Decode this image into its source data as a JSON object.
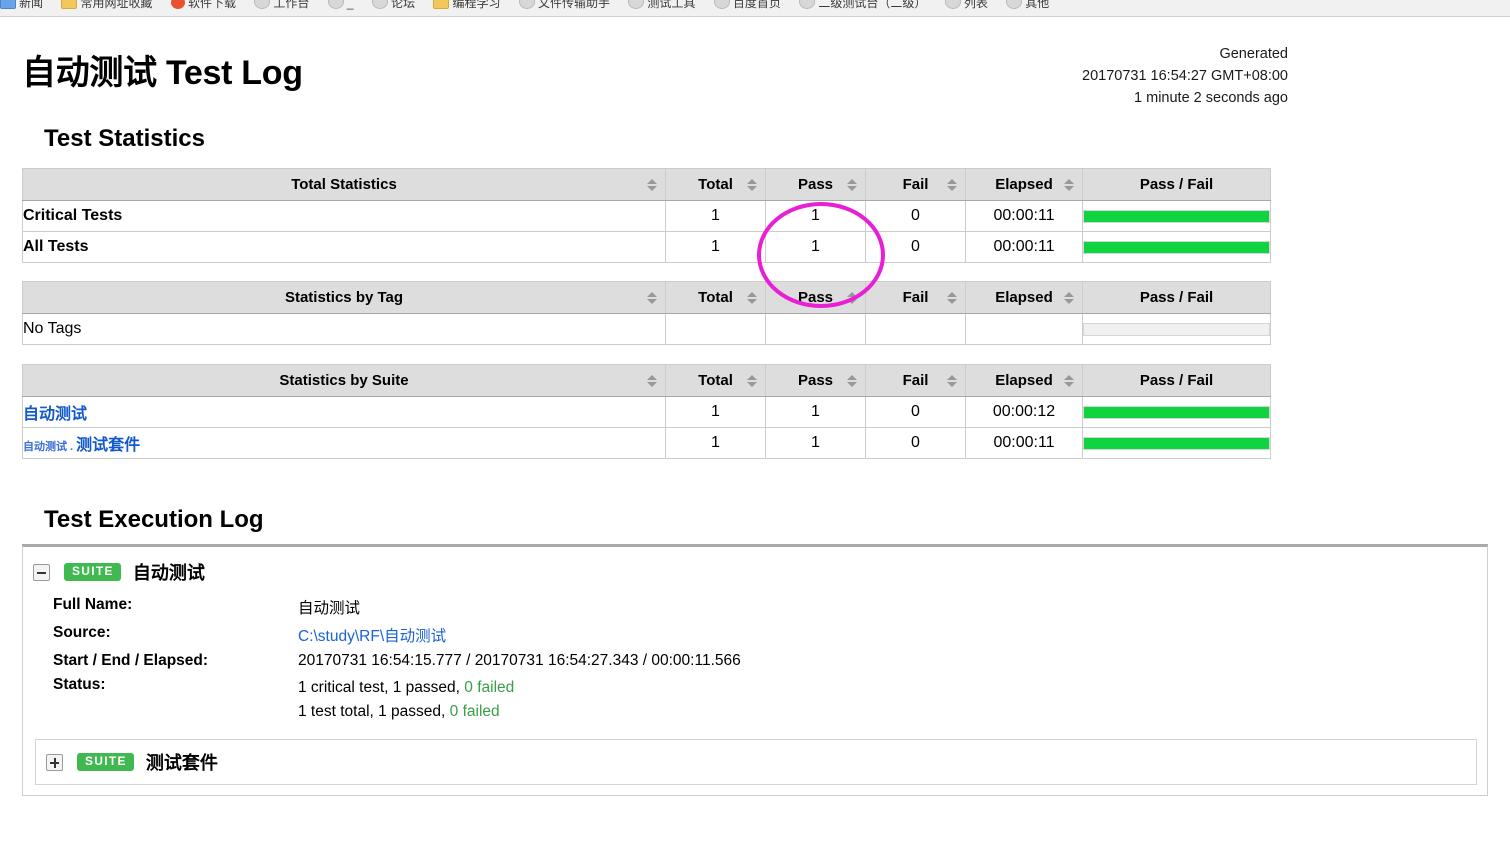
{
  "browser": {
    "bookmarks": [
      {
        "icon": "page-icon",
        "label": "新闻"
      },
      {
        "icon": "folder-icon",
        "label": "常用网址收藏"
      },
      {
        "icon": "red-circle-icon",
        "label": "软件下载"
      },
      {
        "icon": "globe-icon",
        "label": "工作台"
      },
      {
        "icon": "globe-icon",
        "label": "_"
      },
      {
        "icon": "globe-icon",
        "label": "论坛"
      },
      {
        "icon": "folder-icon",
        "label": "编程学习"
      },
      {
        "icon": "globe-icon",
        "label": "文件传输助手"
      },
      {
        "icon": "globe-icon",
        "label": "测试工具"
      },
      {
        "icon": "globe-icon",
        "label": "百度首页"
      },
      {
        "icon": "globe-icon",
        "label": "二级测试台（二级）"
      },
      {
        "icon": "globe-icon",
        "label": "列表"
      },
      {
        "icon": "globe-icon",
        "label": "其他"
      }
    ]
  },
  "report": {
    "title": "自动测试 Test Log",
    "generated_label": "Generated",
    "generated_time": "20170731 16:54:27 GMT+08:00",
    "generated_ago": "1 minute 2 seconds ago"
  },
  "sections": {
    "statistics_heading": "Test Statistics",
    "execution_heading": "Test Execution Log"
  },
  "columns": {
    "total": "Total",
    "pass": "Pass",
    "fail": "Fail",
    "elapsed": "Elapsed",
    "passfail": "Pass / Fail"
  },
  "tables": [
    {
      "id": "total-statistics",
      "name_header": "Total Statistics",
      "rows": [
        {
          "name": "Critical Tests",
          "bold": true,
          "link": false,
          "total": "1",
          "pass": "1",
          "fail": "0",
          "elapsed": "00:00:11",
          "pass_pct": 100
        },
        {
          "name": "All Tests",
          "bold": true,
          "link": false,
          "total": "1",
          "pass": "1",
          "fail": "0",
          "elapsed": "00:00:11",
          "pass_pct": 100
        }
      ]
    },
    {
      "id": "statistics-by-tag",
      "name_header": "Statistics by Tag",
      "rows": [
        {
          "name": "No Tags",
          "bold": false,
          "link": false,
          "total": "",
          "pass": "",
          "fail": "",
          "elapsed": "",
          "pass_pct": -1
        }
      ]
    },
    {
      "id": "statistics-by-suite",
      "name_header": "Statistics by Suite",
      "rows": [
        {
          "name": "自动测试",
          "parent": "",
          "bold": false,
          "link": true,
          "total": "1",
          "pass": "1",
          "fail": "0",
          "elapsed": "00:00:12",
          "pass_pct": 100
        },
        {
          "name": "测试套件",
          "parent": "自动测试 . ",
          "bold": false,
          "link": true,
          "total": "1",
          "pass": "1",
          "fail": "0",
          "elapsed": "00:00:11",
          "pass_pct": 100
        }
      ]
    }
  ],
  "execution_log": {
    "root_suite": {
      "badge": "SUITE",
      "name": "自动测试",
      "toggle_state": "expanded",
      "meta": [
        {
          "label": "Full Name:",
          "value": "自动测试",
          "is_link": false
        },
        {
          "label": "Source:",
          "value": "C:\\study\\RF\\自动测试",
          "is_link": true
        },
        {
          "label": "Start / End / Elapsed:",
          "value": "20170731 16:54:15.777 / 20170731 16:54:27.343 / 00:00:11.566",
          "is_link": false
        }
      ],
      "status_label": "Status:",
      "status_lines": [
        {
          "text": "1 critical test, 1 passed, ",
          "highlight": "0 failed"
        },
        {
          "text": "1 test total, 1 passed, ",
          "highlight": "0 failed"
        }
      ]
    },
    "child_suite": {
      "badge": "SUITE",
      "name": "测试套件",
      "toggle_state": "collapsed"
    }
  },
  "annotation": {
    "type": "ellipse-highlight",
    "target_column": "Pass",
    "color": "#e81fd4"
  },
  "colors": {
    "pass_bar": "#0fd33f",
    "badge_green": "#3fb950",
    "link_blue": "#1359c9",
    "header_gray": "#dddddd"
  }
}
